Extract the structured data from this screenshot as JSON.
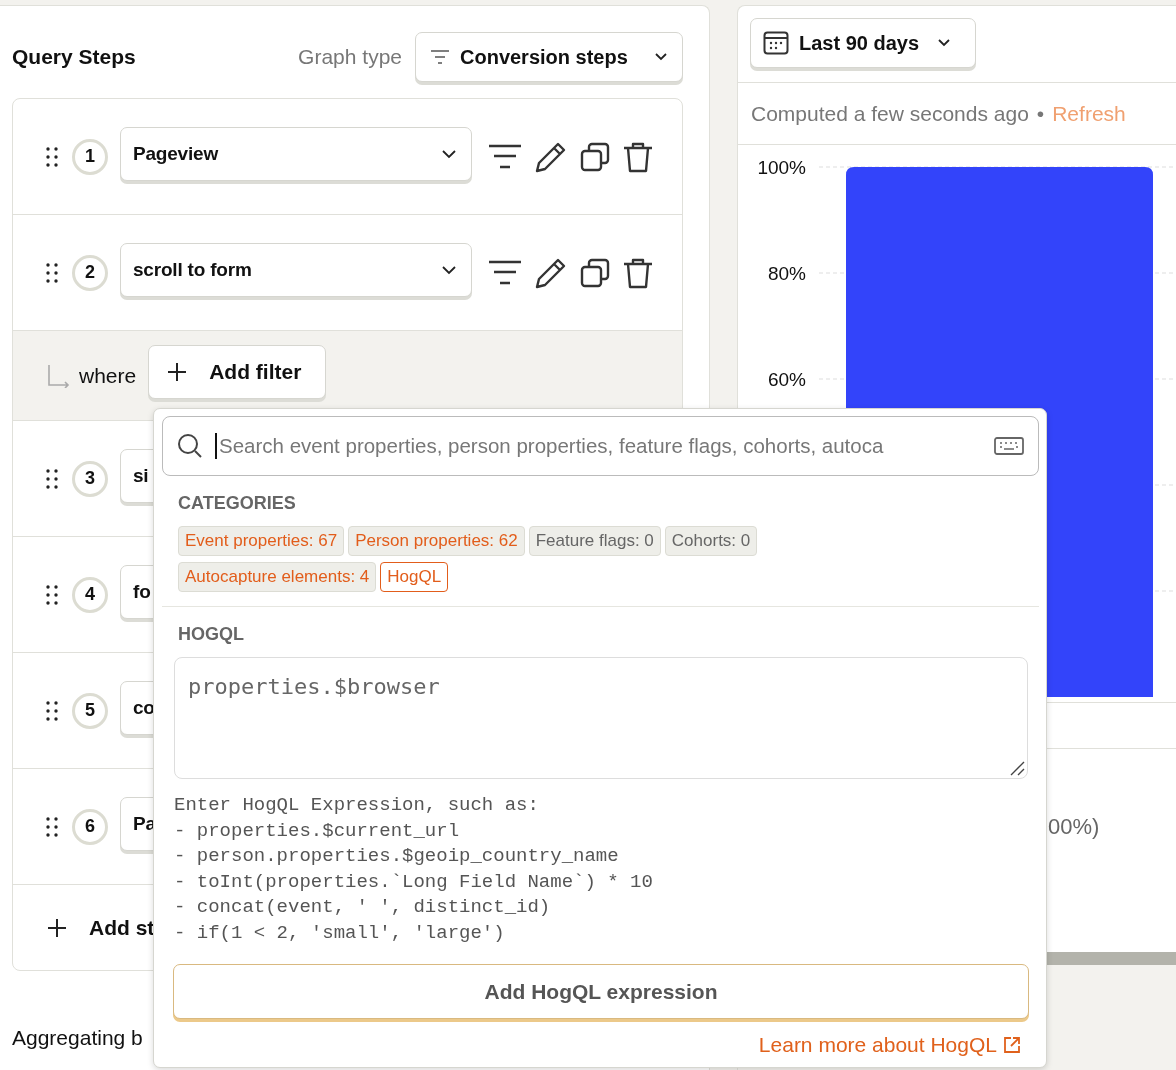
{
  "query_steps": {
    "title": "Query Steps",
    "graph_type_label": "Graph type",
    "graph_type": "Conversion steps",
    "steps": [
      {
        "number": "1",
        "event": "Pageview"
      },
      {
        "number": "2",
        "event": "scroll to form",
        "filter": {
          "connector": "where",
          "button": "Add filter"
        }
      },
      {
        "number": "3",
        "event": "si"
      },
      {
        "number": "4",
        "event": "fo"
      },
      {
        "number": "5",
        "event": "co"
      },
      {
        "number": "6",
        "event": "Pa"
      }
    ],
    "add_step": "Add st",
    "aggregating": "Aggregating b"
  },
  "results": {
    "date_range": "Last 90 days",
    "computed": "Computed a few seconds ago",
    "separator": "•",
    "refresh": "Refresh",
    "chart_data": {
      "type": "bar",
      "values": [
        100
      ],
      "ylim": [
        0,
        100
      ],
      "yticks": [
        {
          "value": 60,
          "label": "60%"
        },
        {
          "value": 80,
          "label": "80%"
        },
        {
          "value": 100,
          "label": "100%"
        }
      ]
    },
    "legend_fragment": "00%)"
  },
  "property_popover": {
    "search_placeholder": "Search event properties, person properties, feature flags, cohorts, autoca",
    "categories_heading": "CATEGORIES",
    "categories": [
      {
        "label": "Event properties: 67",
        "disabled": false,
        "selected": false
      },
      {
        "label": "Person properties: 62",
        "disabled": false,
        "selected": false
      },
      {
        "label": "Feature flags: 0",
        "disabled": true,
        "selected": false
      },
      {
        "label": "Cohorts: 0",
        "disabled": true,
        "selected": false
      },
      {
        "label": "Autocapture elements: 4",
        "disabled": false,
        "selected": false
      },
      {
        "label": "HogQL",
        "disabled": false,
        "selected": true
      }
    ],
    "hogql_heading": "HOGQL",
    "expression_placeholder": "properties.$browser",
    "help_lines": [
      "Enter HogQL Expression, such as:",
      "- properties.$current_url",
      "- person.properties.$geoip_country_name",
      "- toInt(properties.`Long Field Name`) * 10",
      "- concat(event, ' ', distinct_id)",
      "- if(1 < 2, 'small', 'large')"
    ],
    "submit": "Add HogQL expression",
    "learn_more": "Learn more about HogQL"
  }
}
